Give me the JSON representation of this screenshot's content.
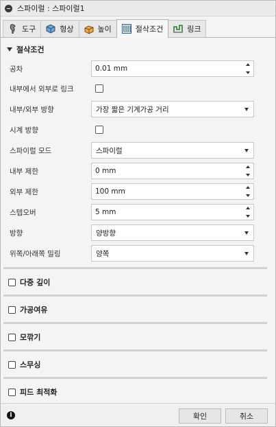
{
  "title": "스파이럴 : 스파이럴1",
  "tabs": [
    {
      "label": "도구",
      "icon": "tool-icon"
    },
    {
      "label": "형상",
      "icon": "geometry-icon"
    },
    {
      "label": "높이",
      "icon": "heights-icon"
    },
    {
      "label": "절삭조건",
      "icon": "passes-icon",
      "active": true
    },
    {
      "label": "링크",
      "icon": "linking-icon"
    }
  ],
  "section_title": "절삭조건",
  "fields": {
    "tolerance": {
      "label": "공차",
      "value": "0.01 mm"
    },
    "link_in_out": {
      "label": "내부에서 외부로 링크"
    },
    "in_out_direction": {
      "label": "내부/외부 방향",
      "value": "가장 짧은 기계가공 거리"
    },
    "clockwise": {
      "label": "시계 방향"
    },
    "spiral_mode": {
      "label": "스파이럴 모드",
      "value": "스파이럴"
    },
    "inner_limit": {
      "label": "내부 제한",
      "value": "0 mm"
    },
    "outer_limit": {
      "label": "외부 제한",
      "value": "100 mm"
    },
    "stepover": {
      "label": "스텝오버",
      "value": "5 mm"
    },
    "direction": {
      "label": "방향",
      "value": "양방향"
    },
    "up_down_milling": {
      "label": "위쪽/아래쪽 밀링",
      "value": "양쪽"
    }
  },
  "collapsed_sections": [
    "다중 깊이",
    "가공여유",
    "모깎기",
    "스무싱",
    "피드 최적화"
  ],
  "footer": {
    "ok": "확인",
    "cancel": "취소"
  }
}
